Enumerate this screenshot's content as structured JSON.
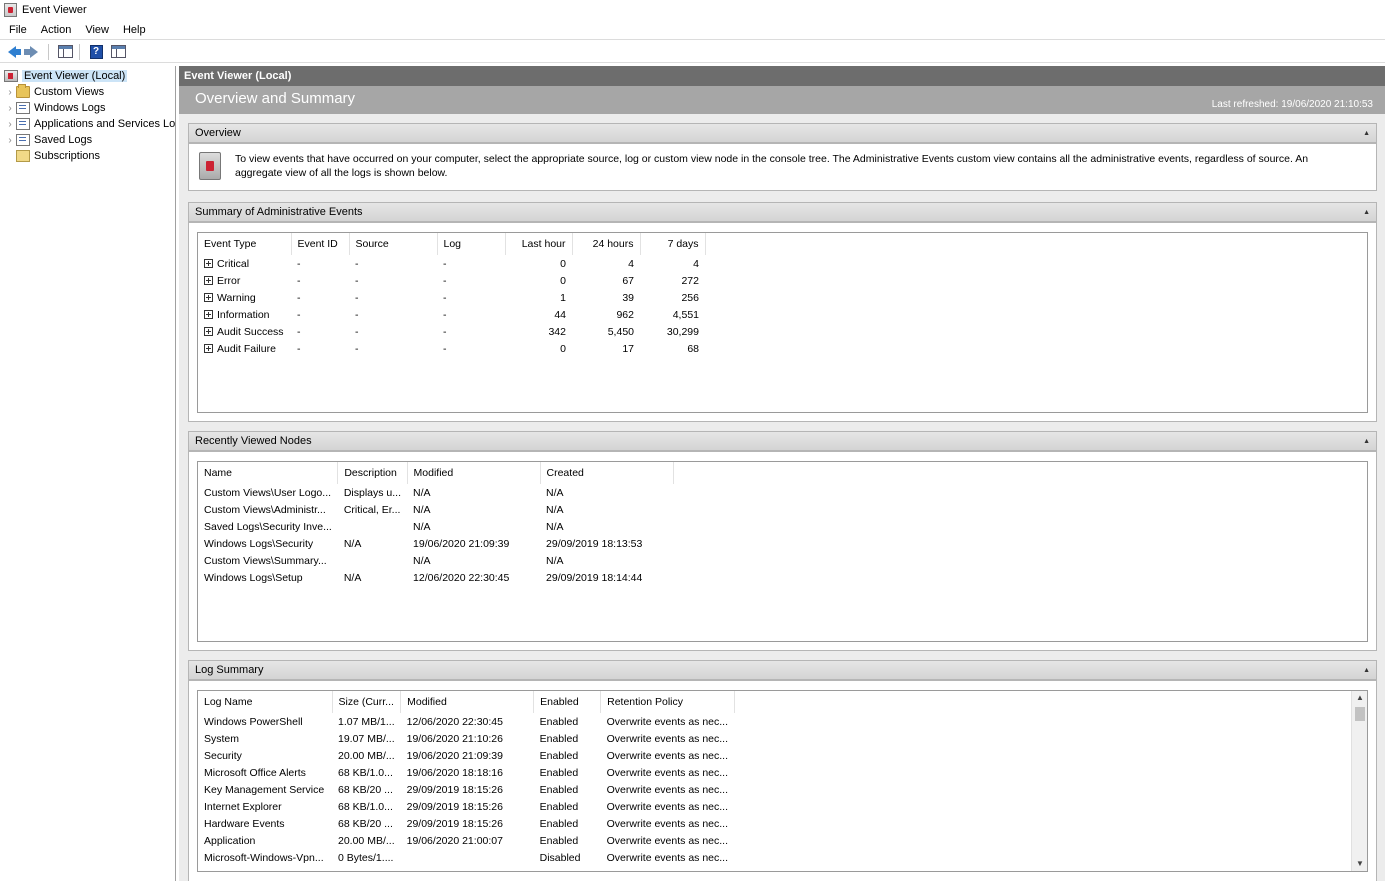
{
  "window": {
    "title": "Event Viewer"
  },
  "menu": [
    "File",
    "Action",
    "View",
    "Help"
  ],
  "toolbar": {
    "icons": [
      "back-arrow-icon",
      "forward-arrow-icon",
      "show-hide-console-tree-icon",
      "help-icon",
      "show-hide-action-pane-icon"
    ]
  },
  "tree": {
    "root": "Event Viewer (Local)",
    "items": [
      {
        "label": "Custom Views",
        "icon": "folder-icon"
      },
      {
        "label": "Windows Logs",
        "icon": "folder-icon"
      },
      {
        "label": "Applications and Services Lo",
        "icon": "folder-icon"
      },
      {
        "label": "Saved Logs",
        "icon": "folder-icon"
      },
      {
        "label": "Subscriptions",
        "icon": "subscriptions-icon"
      }
    ]
  },
  "main": {
    "header": "Event Viewer (Local)",
    "banner_title": "Overview and Summary",
    "last_refreshed": "Last refreshed: 19/06/2020 21:10:53"
  },
  "overview": {
    "title": "Overview",
    "text": "To view events that have occurred on your computer, select the appropriate source, log or custom view node in the console tree. The Administrative Events custom view contains all the administrative events, regardless of source. An aggregate view of all the logs is shown below."
  },
  "summary": {
    "title": "Summary of Administrative Events",
    "columns": [
      "Event Type",
      "Event ID",
      "Source",
      "Log",
      "Last hour",
      "24 hours",
      "7 days"
    ],
    "rows": [
      [
        "Critical",
        "-",
        "-",
        "-",
        "0",
        "4",
        "4"
      ],
      [
        "Error",
        "-",
        "-",
        "-",
        "0",
        "67",
        "272"
      ],
      [
        "Warning",
        "-",
        "-",
        "-",
        "1",
        "39",
        "256"
      ],
      [
        "Information",
        "-",
        "-",
        "-",
        "44",
        "962",
        "4,551"
      ],
      [
        "Audit Success",
        "-",
        "-",
        "-",
        "342",
        "5,450",
        "30,299"
      ],
      [
        "Audit Failure",
        "-",
        "-",
        "-",
        "0",
        "17",
        "68"
      ]
    ]
  },
  "recent": {
    "title": "Recently Viewed Nodes",
    "columns": [
      "Name",
      "Description",
      "Modified",
      "Created"
    ],
    "rows": [
      [
        "Custom Views\\User Logo...",
        "Displays u...",
        "N/A",
        "N/A"
      ],
      [
        "Custom Views\\Administr...",
        "Critical, Er...",
        "N/A",
        "N/A"
      ],
      [
        "Saved Logs\\Security Inve...",
        "",
        "N/A",
        "N/A"
      ],
      [
        "Windows Logs\\Security",
        "N/A",
        "19/06/2020 21:09:39",
        "29/09/2019 18:13:53"
      ],
      [
        "Custom Views\\Summary...",
        "",
        "N/A",
        "N/A"
      ],
      [
        "Windows Logs\\Setup",
        "N/A",
        "12/06/2020 22:30:45",
        "29/09/2019 18:14:44"
      ]
    ]
  },
  "logsummary": {
    "title": "Log Summary",
    "columns": [
      "Log Name",
      "Size (Curr...",
      "Modified",
      "Enabled",
      "Retention Policy"
    ],
    "rows": [
      [
        "Windows PowerShell",
        "1.07 MB/1...",
        "12/06/2020 22:30:45",
        "Enabled",
        "Overwrite events as nec..."
      ],
      [
        "System",
        "19.07 MB/...",
        "19/06/2020 21:10:26",
        "Enabled",
        "Overwrite events as nec..."
      ],
      [
        "Security",
        "20.00 MB/...",
        "19/06/2020 21:09:39",
        "Enabled",
        "Overwrite events as nec..."
      ],
      [
        "Microsoft Office Alerts",
        "68 KB/1.0...",
        "19/06/2020 18:18:16",
        "Enabled",
        "Overwrite events as nec..."
      ],
      [
        "Key Management Service",
        "68 KB/20 ...",
        "29/09/2019 18:15:26",
        "Enabled",
        "Overwrite events as nec..."
      ],
      [
        "Internet Explorer",
        "68 KB/1.0...",
        "29/09/2019 18:15:26",
        "Enabled",
        "Overwrite events as nec..."
      ],
      [
        "Hardware Events",
        "68 KB/20 ...",
        "29/09/2019 18:15:26",
        "Enabled",
        "Overwrite events as nec..."
      ],
      [
        "Application",
        "20.00 MB/...",
        "19/06/2020 21:00:07",
        "Enabled",
        "Overwrite events as nec..."
      ],
      [
        "Microsoft-Windows-Vpn...",
        "0 Bytes/1....",
        "",
        "Disabled",
        "Overwrite events as nec..."
      ]
    ]
  }
}
